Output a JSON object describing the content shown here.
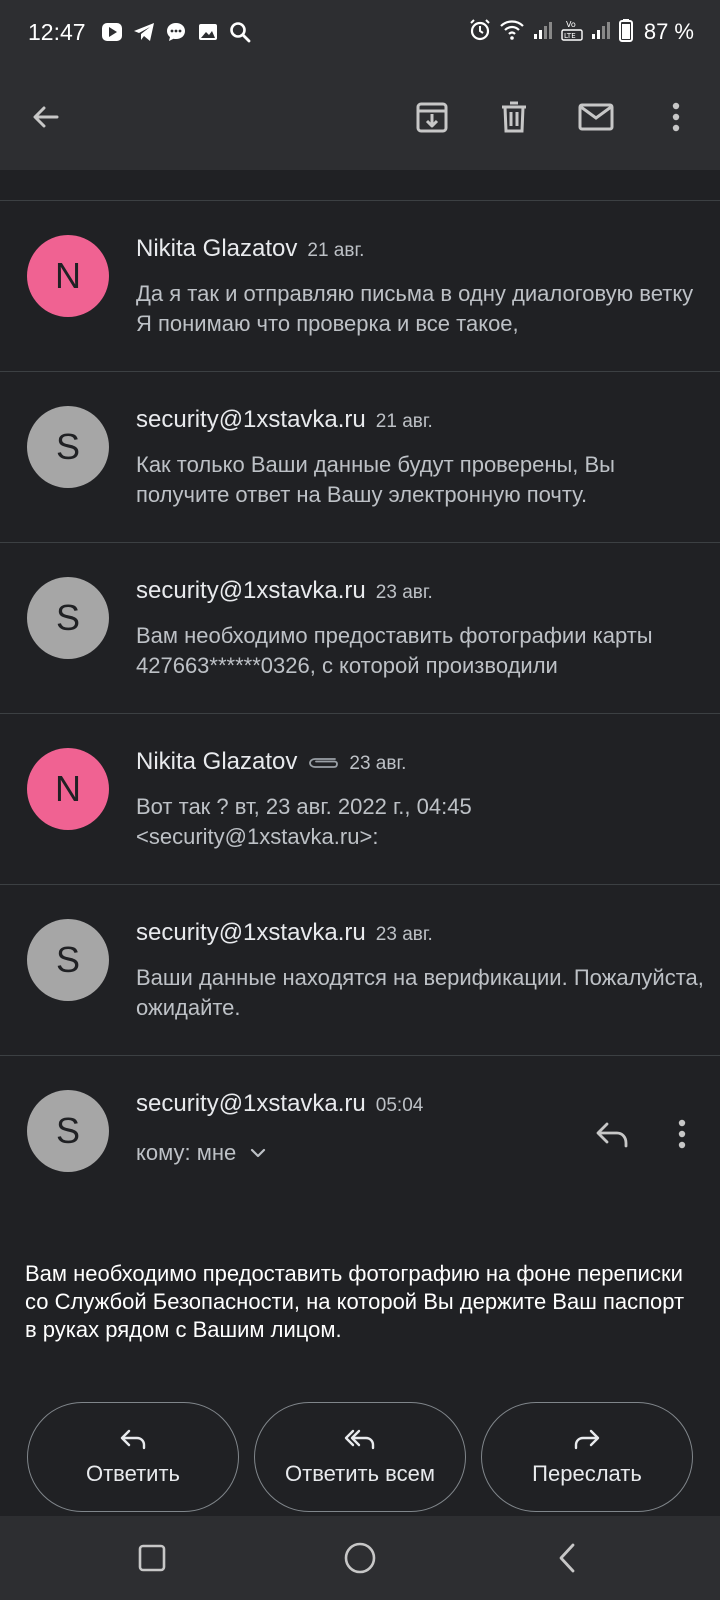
{
  "status_bar": {
    "time": "12:47",
    "battery": "87 %",
    "app_icons": [
      "youtube-icon",
      "telegram-icon",
      "messages-icon",
      "gallery-icon",
      "search-icon"
    ],
    "system_icons": [
      "alarm-icon",
      "wifi-icon",
      "signal-icon",
      "volte-icon",
      "signal-icon",
      "battery-icon"
    ]
  },
  "toolbar": {
    "icons": [
      "back-arrow-icon",
      "archive-icon",
      "delete-icon",
      "mark-unread-icon",
      "more-vert-icon"
    ]
  },
  "thread": {
    "messages": [
      {
        "initial": "N",
        "sender": "Nikita Glazatov",
        "date": "21 авг.",
        "snippet": "Да я так и отправляю письма в одну диалоговую ветку Я понимаю что проверка и все такое,",
        "avatar_color": "#f06292"
      },
      {
        "initial": "S",
        "sender": "security@1xstavka.ru",
        "date": "21 авг.",
        "snippet": "Как только Ваши данные будут проверены, Вы получите ответ на Вашу электронную почту.",
        "avatar_color": "#a6a6a6"
      },
      {
        "initial": "S",
        "sender": "security@1xstavka.ru",
        "date": "23 авг.",
        "snippet": "Вам необходимо предоставить фотографии карты 427663******0326, с которой производили",
        "avatar_color": "#a6a6a6"
      },
      {
        "initial": "N",
        "sender": "Nikita Glazatov",
        "date": "23 авг.",
        "snippet": "Вот так ? вт, 23 авг. 2022 г., 04:45 <security@1xstavka.ru>:",
        "avatar_color": "#f06292",
        "has_attachment": true
      },
      {
        "initial": "S",
        "sender": "security@1xstavka.ru",
        "date": "23 авг.",
        "snippet": "Ваши данные находятся на верификации. Пожалуйста, ожидайте.",
        "avatar_color": "#a6a6a6"
      }
    ],
    "expanded": {
      "initial": "S",
      "sender": "security@1xstavka.ru",
      "time": "05:04",
      "recipient": "кому: мне",
      "body": "Вам необходимо предоставить фотографию на фоне переписки со Службой Безопасности, на которой Вы держите Ваш паспорт в руках рядом с Вашим лицом.",
      "avatar_color": "#a6a6a6"
    },
    "actions": {
      "reply": "Ответить",
      "reply_all": "Ответить всем",
      "forward": "Переслать"
    }
  },
  "nav": {
    "icons": [
      "recents-icon",
      "home-icon",
      "back-icon"
    ]
  }
}
